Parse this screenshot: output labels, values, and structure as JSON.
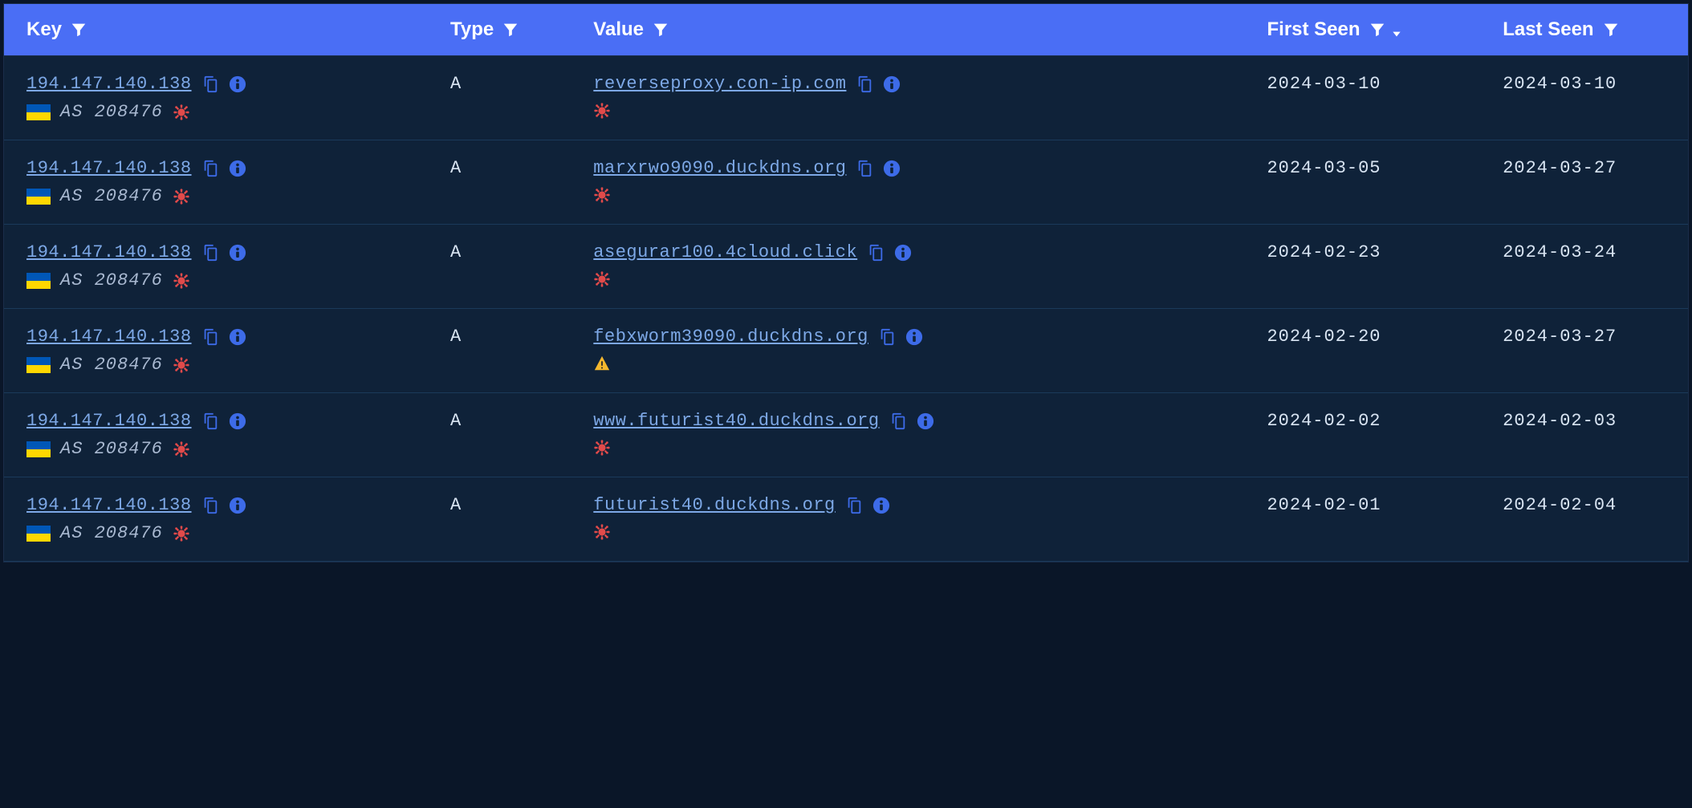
{
  "columns": {
    "key": "Key",
    "type": "Type",
    "value": "Value",
    "first_seen": "First Seen",
    "last_seen": "Last Seen"
  },
  "rows": [
    {
      "key_ip": "194.147.140.138",
      "key_country": "UA",
      "key_as": "AS 208476",
      "key_threat": "malware",
      "type": "A",
      "value_host": "reverseproxy.con-ip.com",
      "value_threat": "malware",
      "first_seen": "2024-03-10",
      "last_seen": "2024-03-10"
    },
    {
      "key_ip": "194.147.140.138",
      "key_country": "UA",
      "key_as": "AS 208476",
      "key_threat": "malware",
      "type": "A",
      "value_host": "marxrwo9090.duckdns.org",
      "value_threat": "malware",
      "first_seen": "2024-03-05",
      "last_seen": "2024-03-27"
    },
    {
      "key_ip": "194.147.140.138",
      "key_country": "UA",
      "key_as": "AS 208476",
      "key_threat": "malware",
      "type": "A",
      "value_host": "asegurar100.4cloud.click",
      "value_threat": "malware",
      "first_seen": "2024-02-23",
      "last_seen": "2024-03-24"
    },
    {
      "key_ip": "194.147.140.138",
      "key_country": "UA",
      "key_as": "AS 208476",
      "key_threat": "malware",
      "type": "A",
      "value_host": "febxworm39090.duckdns.org",
      "value_threat": "warning",
      "first_seen": "2024-02-20",
      "last_seen": "2024-03-27"
    },
    {
      "key_ip": "194.147.140.138",
      "key_country": "UA",
      "key_as": "AS 208476",
      "key_threat": "malware",
      "type": "A",
      "value_host": "www.futurist40.duckdns.org",
      "value_threat": "malware",
      "first_seen": "2024-02-02",
      "last_seen": "2024-02-03"
    },
    {
      "key_ip": "194.147.140.138",
      "key_country": "UA",
      "key_as": "AS 208476",
      "key_threat": "malware",
      "type": "A",
      "value_host": "futurist40.duckdns.org",
      "value_threat": "malware",
      "first_seen": "2024-02-01",
      "last_seen": "2024-02-04"
    }
  ],
  "icons": {
    "filter": "filter",
    "sort_desc": "sort-desc",
    "copy": "copy",
    "info": "info",
    "malware": "virus",
    "warning": "warning"
  }
}
